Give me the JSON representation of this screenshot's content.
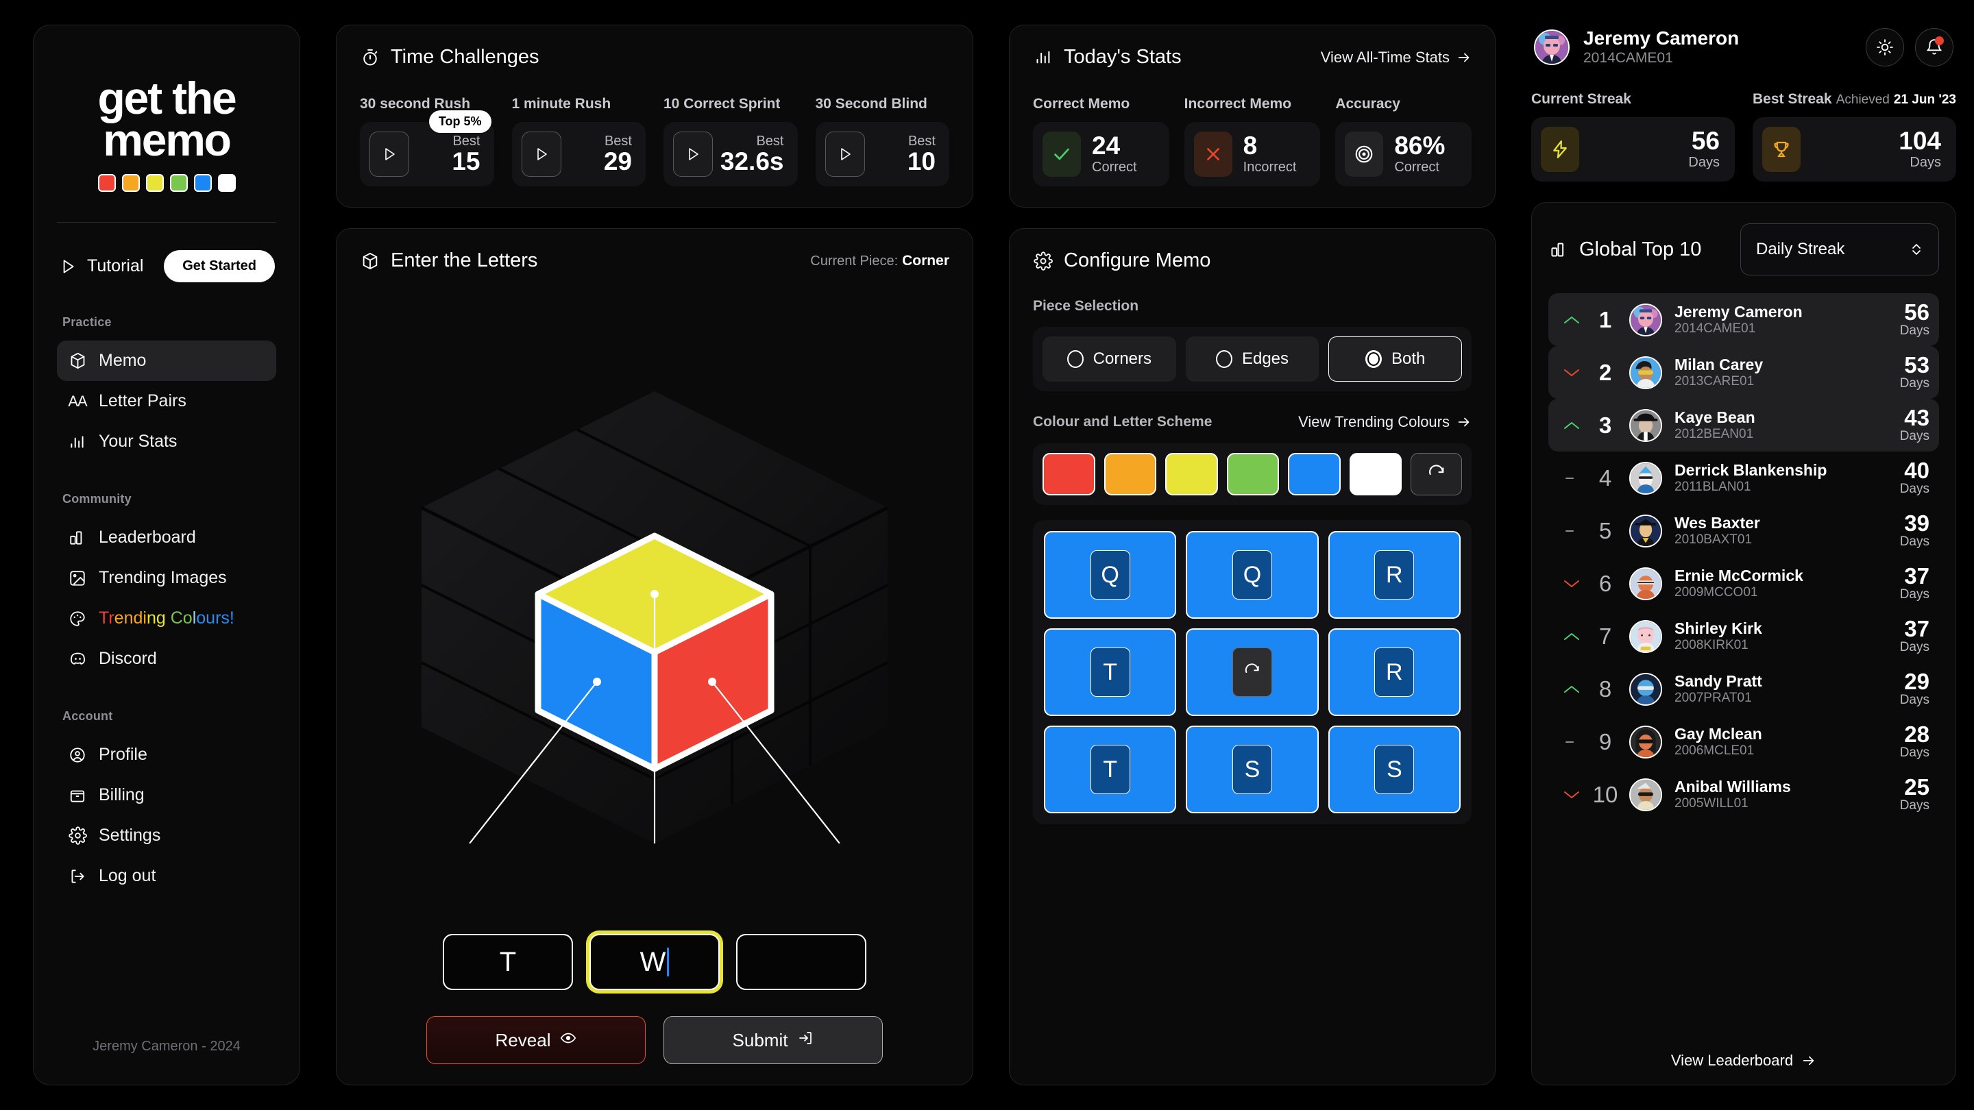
{
  "brand": {
    "logo_line1": "get the",
    "logo_line2": "memo",
    "swatches": [
      "#ef4136",
      "#f5a623",
      "#e8e337",
      "#7ac74f",
      "#1a87f5",
      "#ffffff"
    ]
  },
  "sidebar": {
    "tutorial_label": "Tutorial",
    "get_started_label": "Get Started",
    "section_practice": "Practice",
    "section_community": "Community",
    "section_account": "Account",
    "items": [
      {
        "label": "Memo",
        "icon": "cube-icon",
        "active": true
      },
      {
        "label": "Letter Pairs",
        "icon": "aa-icon",
        "active": false
      },
      {
        "label": "Your Stats",
        "icon": "bar-chart-icon",
        "active": false
      },
      {
        "label": "Leaderboard",
        "icon": "podium-icon",
        "active": false
      },
      {
        "label": "Trending Images",
        "icon": "image-icon",
        "active": false
      },
      {
        "label": "Trending Colours!",
        "icon": "palette-icon",
        "active": false
      },
      {
        "label": "Discord",
        "icon": "discord-icon",
        "active": false
      },
      {
        "label": "Profile",
        "icon": "user-circle-icon",
        "active": false
      },
      {
        "label": "Billing",
        "icon": "wallet-icon",
        "active": false
      },
      {
        "label": "Settings",
        "icon": "gear-icon",
        "active": false
      },
      {
        "label": "Log out",
        "icon": "logout-icon",
        "active": false
      }
    ],
    "footer": "Jeremy Cameron - 2024"
  },
  "time_challenges": {
    "title": "Time Challenges",
    "icon": "stopwatch-icon",
    "items": [
      {
        "label": "30 second Rush",
        "best_label": "Best",
        "best_value": "15",
        "badge": "Top 5%"
      },
      {
        "label": "1 minute Rush",
        "best_label": "Best",
        "best_value": "29",
        "badge": ""
      },
      {
        "label": "10 Correct Sprint",
        "best_label": "Best",
        "best_value": "32.6s",
        "badge": ""
      },
      {
        "label": "30 Second Blind",
        "best_label": "Best",
        "best_value": "10",
        "badge": ""
      }
    ]
  },
  "enter_letters": {
    "title": "Enter the Letters",
    "icon": "cube-icon",
    "current_piece_label": "Current Piece:",
    "current_piece_value": "Corner",
    "cube_face_colors": {
      "top": "#e8e337",
      "left": "#1a87f5",
      "right": "#ef4136"
    },
    "inputs": [
      {
        "value": "T",
        "focused": false
      },
      {
        "value": "W",
        "focused": true
      },
      {
        "value": "",
        "focused": false
      }
    ],
    "reveal_label": "Reveal",
    "submit_label": "Submit"
  },
  "todays_stats": {
    "title": "Today's Stats",
    "icon": "bar-chart-icon",
    "link_label": "View All-Time Stats",
    "items": [
      {
        "label": "Correct Memo",
        "value": "24",
        "sub": "Correct",
        "icon": "check-icon",
        "color": "#4ad16b"
      },
      {
        "label": "Incorrect Memo",
        "value": "8",
        "sub": "Incorrect",
        "icon": "cross-icon",
        "color": "#e8492f"
      },
      {
        "label": "Accuracy",
        "value": "86%",
        "sub": "Correct",
        "icon": "target-icon",
        "color": "#ffffff"
      }
    ]
  },
  "configure_memo": {
    "title": "Configure Memo",
    "icon": "gear-icon",
    "piece_selection_label": "Piece Selection",
    "piece_options": [
      {
        "label": "Corners",
        "selected": false
      },
      {
        "label": "Edges",
        "selected": false
      },
      {
        "label": "Both",
        "selected": true
      }
    ],
    "colour_scheme_label": "Colour and Letter Scheme",
    "trending_link": "View Trending Colours",
    "swatches": [
      "#ef4136",
      "#f5a623",
      "#e8e337",
      "#7ac74f",
      "#1a87f5",
      "#ffffff"
    ],
    "reset_swatch_icon": "refresh-icon",
    "letter_grid": [
      {
        "letter": "Q",
        "reset": false
      },
      {
        "letter": "Q",
        "reset": false
      },
      {
        "letter": "R",
        "reset": false
      },
      {
        "letter": "T",
        "reset": false
      },
      {
        "letter": "",
        "reset": true
      },
      {
        "letter": "R",
        "reset": false
      },
      {
        "letter": "T",
        "reset": false
      },
      {
        "letter": "S",
        "reset": false
      },
      {
        "letter": "S",
        "reset": false
      }
    ]
  },
  "user": {
    "name": "Jeremy Cameron",
    "id": "2014CAME01",
    "theme_icon": "sun-icon",
    "bell_icon": "bell-icon",
    "has_notification": true
  },
  "streaks": {
    "current_label": "Current Streak",
    "current_value": "56",
    "current_unit": "Days",
    "current_icon": "lightning-icon",
    "best_label": "Best Streak",
    "best_value": "104",
    "best_unit": "Days",
    "best_icon": "trophy-icon",
    "achieved_label": "Achieved",
    "achieved_date": "21 Jun '23"
  },
  "leaderboard": {
    "title": "Global Top 10",
    "icon": "podium-icon",
    "filter_value": "Daily Streak",
    "unit": "Days",
    "footer_link": "View Leaderboard",
    "rows": [
      {
        "rank": "1",
        "trend": "up",
        "name": "Jeremy Cameron",
        "id": "2014CAME01",
        "value": "56",
        "highlight": true
      },
      {
        "rank": "2",
        "trend": "down",
        "name": "Milan Carey",
        "id": "2013CARE01",
        "value": "53",
        "highlight": true
      },
      {
        "rank": "3",
        "trend": "up",
        "name": "Kaye Bean",
        "id": "2012BEAN01",
        "value": "43",
        "highlight": true
      },
      {
        "rank": "4",
        "trend": "flat",
        "name": "Derrick Blankenship",
        "id": "2011BLAN01",
        "value": "40",
        "highlight": false
      },
      {
        "rank": "5",
        "trend": "flat",
        "name": "Wes Baxter",
        "id": "2010BAXT01",
        "value": "39",
        "highlight": false
      },
      {
        "rank": "6",
        "trend": "down",
        "name": "Ernie McCormick",
        "id": "2009MCCO01",
        "value": "37",
        "highlight": false
      },
      {
        "rank": "7",
        "trend": "up",
        "name": "Shirley Kirk",
        "id": "2008KIRK01",
        "value": "37",
        "highlight": false
      },
      {
        "rank": "8",
        "trend": "up",
        "name": "Sandy Pratt",
        "id": "2007PRAT01",
        "value": "29",
        "highlight": false
      },
      {
        "rank": "9",
        "trend": "flat",
        "name": "Gay Mclean",
        "id": "2006MCLE01",
        "value": "28",
        "highlight": false
      },
      {
        "rank": "10",
        "trend": "down",
        "name": "Anibal Williams",
        "id": "2005WILL01",
        "value": "25",
        "highlight": false
      }
    ]
  }
}
